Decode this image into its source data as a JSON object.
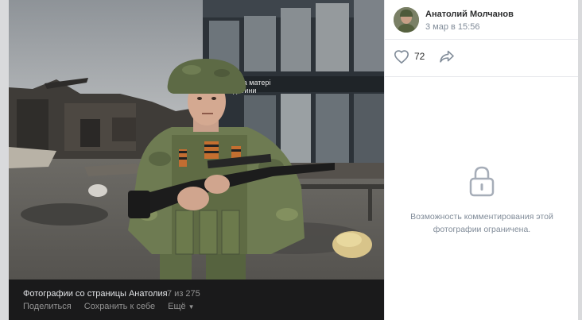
{
  "photo": {
    "album_title": "Фотографии со страницы Анатолия",
    "position": "7 из 275",
    "actions": {
      "share": "Поделиться",
      "save": "Сохранить к себе",
      "more": "Ещё"
    },
    "sign_text_line1": "рната матері",
    "sign_text_line2": "дитини"
  },
  "post": {
    "author_name": "Анатолий Молчанов",
    "date": "3 мар в 15:56",
    "likes": "72",
    "comments_restricted_text": "Возможность комментирования этой фотографии ограничена."
  },
  "icons": {
    "like": "heart-icon",
    "share": "share-arrow-icon",
    "lock": "lock-icon",
    "more": "chevron-down-icon"
  },
  "colors": {
    "caption_bg": "#1a1a1b",
    "muted_text": "#818c99",
    "lock_gray": "#a6adb8"
  }
}
